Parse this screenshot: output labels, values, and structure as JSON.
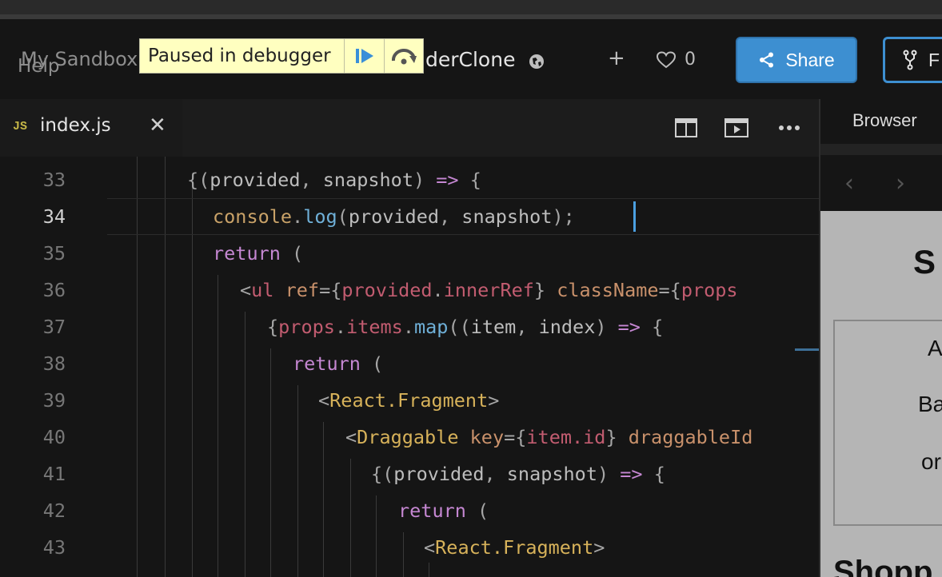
{
  "header": {
    "sandbox_label": "My Sandbox",
    "help_label": "Help",
    "project_name_partial": "derClone",
    "like_count": "0",
    "share_label": "Share",
    "fork_label": "F"
  },
  "debugger": {
    "label": "Paused in debugger"
  },
  "editor": {
    "active_tab": "index.js",
    "tab_badge": "JS",
    "active_line": 34,
    "lines": [
      {
        "n": "33"
      },
      {
        "n": "34"
      },
      {
        "n": "35"
      },
      {
        "n": "36"
      },
      {
        "n": "37"
      },
      {
        "n": "38"
      },
      {
        "n": "39"
      },
      {
        "n": "40"
      },
      {
        "n": "41"
      },
      {
        "n": "42"
      },
      {
        "n": "43"
      }
    ]
  },
  "browser": {
    "tab_label": "Browser",
    "back_icon": "‹",
    "forward_icon": "›",
    "preview_heading_partial": "S",
    "preview_items_partial": [
      "A",
      "Ba",
      "or"
    ],
    "preview_subheading_partial": "Shopp"
  },
  "colors": {
    "accent": "#3d8fd1",
    "debugger_bg": "#ffffc0",
    "editor_bg": "#151515"
  }
}
